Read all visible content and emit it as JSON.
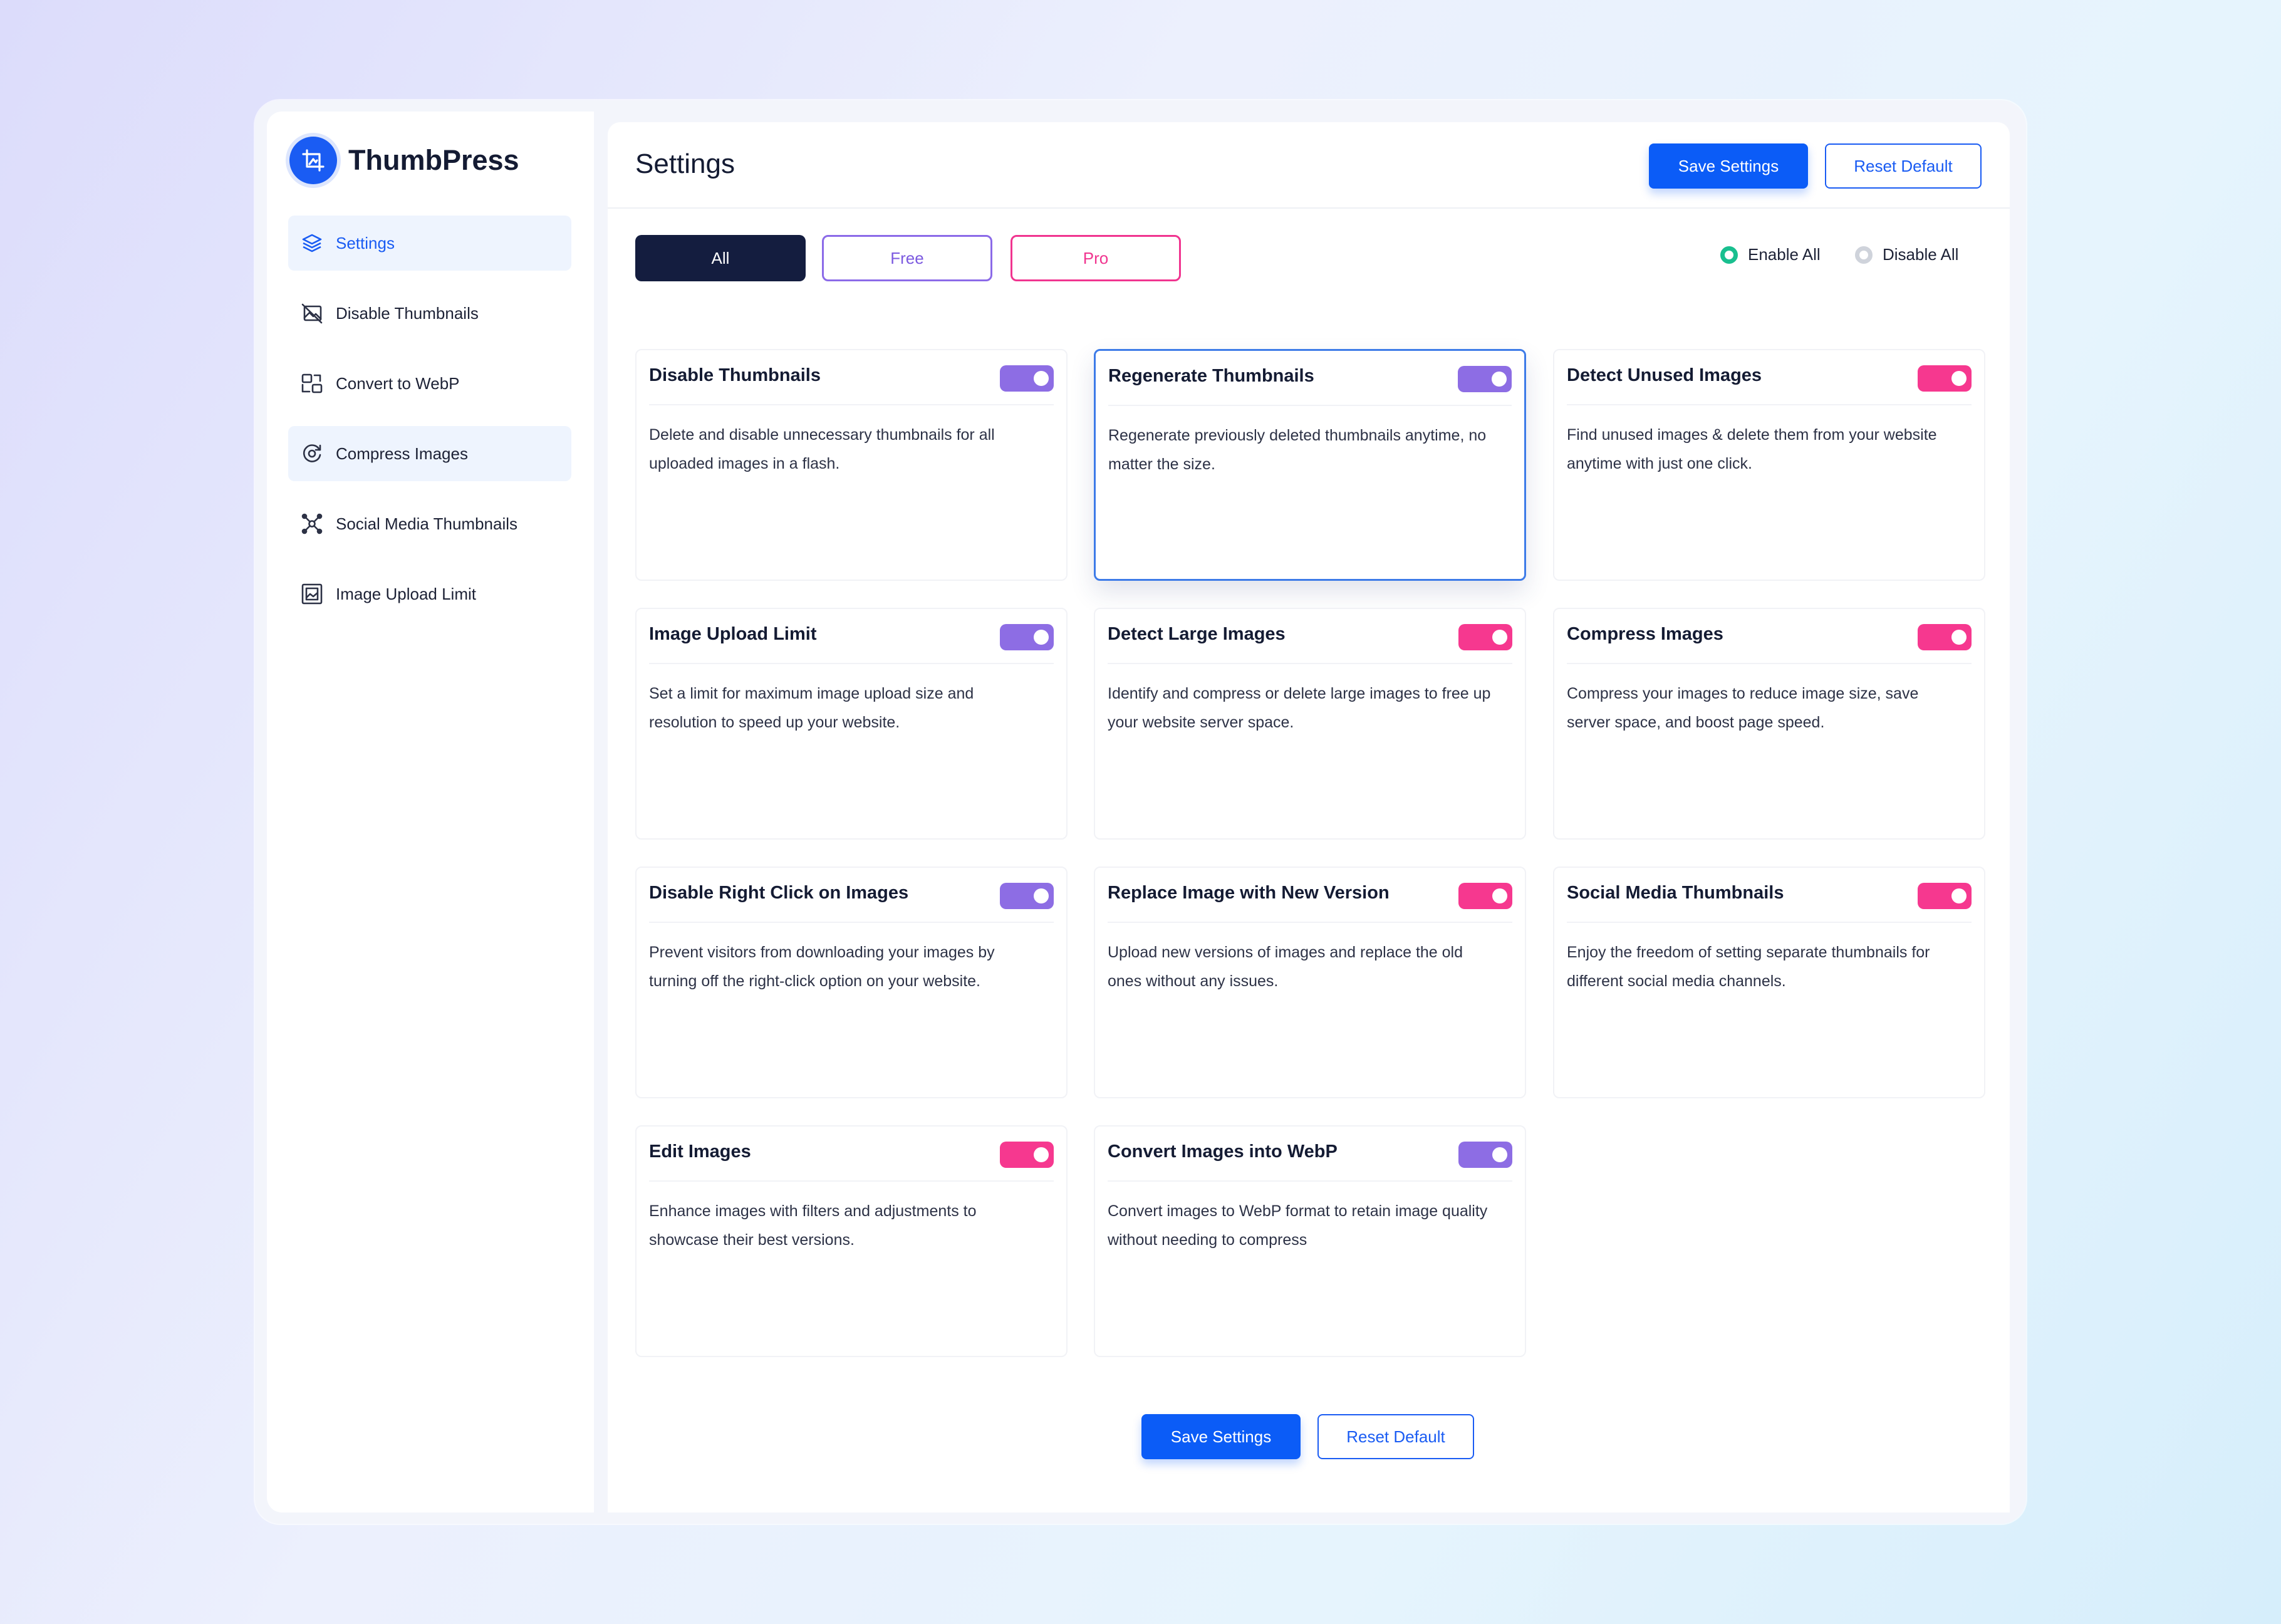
{
  "app": {
    "name": "ThumbPress"
  },
  "sidebar": {
    "items": [
      {
        "label": "Settings",
        "icon": "layers-icon"
      },
      {
        "label": "Disable Thumbnails",
        "icon": "image-off-icon"
      },
      {
        "label": "Convert to WebP",
        "icon": "convert-icon"
      },
      {
        "label": "Compress Images",
        "icon": "compress-icon"
      },
      {
        "label": "Social Media Thumbnails",
        "icon": "share-nodes-icon"
      },
      {
        "label": "Image Upload Limit",
        "icon": "image-frame-icon"
      }
    ]
  },
  "header": {
    "title": "Settings",
    "save_label": "Save Settings",
    "reset_label": "Reset Default"
  },
  "filters": {
    "all": "All",
    "free": "Free",
    "pro": "Pro",
    "enable_all": "Enable All",
    "disable_all": "Disable All"
  },
  "cards": [
    {
      "title": "Disable Thumbnails",
      "desc": "Delete and disable unnecessary thumbnails for all uploaded images in a flash.",
      "tier": "free",
      "enabled": true
    },
    {
      "title": "Regenerate Thumbnails",
      "desc": "Regenerate previously deleted thumbnails anytime, no matter the size.",
      "tier": "free",
      "enabled": true
    },
    {
      "title": "Detect Unused Images",
      "desc": "Find unused images & delete them from your website anytime with just one click.",
      "tier": "pro",
      "enabled": true
    },
    {
      "title": "Image Upload Limit",
      "desc": "Set a limit for maximum image upload size and resolution to speed up your website.",
      "tier": "free",
      "enabled": true
    },
    {
      "title": "Detect Large Images",
      "desc": "Identify and compress or delete large images to free up your website server space.",
      "tier": "pro",
      "enabled": true
    },
    {
      "title": "Compress Images",
      "desc": "Compress your images to reduce image size, save server space, and boost page speed.",
      "tier": "pro",
      "enabled": true
    },
    {
      "title": "Disable Right Click on Images",
      "desc": "Prevent visitors from downloading your images by turning off the right-click option on your website.",
      "tier": "free",
      "enabled": true
    },
    {
      "title": "Replace Image with New Version",
      "desc": "Upload new versions of images and replace the old ones without any issues.",
      "tier": "pro",
      "enabled": true
    },
    {
      "title": "Social Media Thumbnails",
      "desc": "Enjoy the freedom of setting separate thumbnails for different social media channels.",
      "tier": "pro",
      "enabled": true
    },
    {
      "title": "Edit Images",
      "desc": "Enhance images with filters and adjustments to showcase their best versions.",
      "tier": "pro",
      "enabled": true
    },
    {
      "title": "Convert Images into WebP",
      "desc": "Convert images to WebP format to retain image quality without needing to compress",
      "tier": "free",
      "enabled": true
    }
  ],
  "footer": {
    "save_label": "Save Settings",
    "reset_label": "Reset Default"
  },
  "colors": {
    "primary": "#0b5cf7",
    "free_accent": "#8d6de4",
    "pro_accent": "#f6388f",
    "enable_radio": "#19bf8f"
  }
}
